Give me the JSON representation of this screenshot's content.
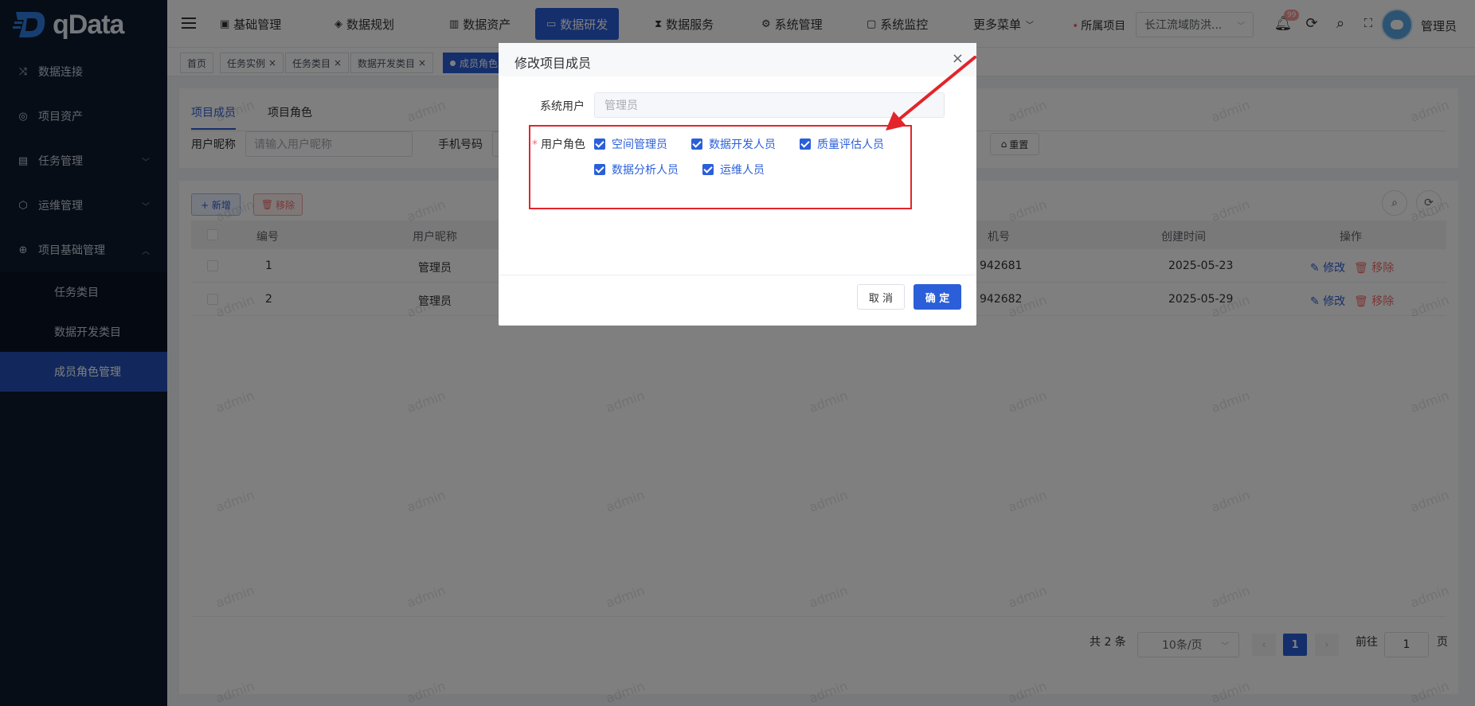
{
  "app": {
    "name": "qData"
  },
  "sidebar": {
    "items": [
      {
        "label": "数据连接",
        "icon": "shuffle-icon"
      },
      {
        "label": "项目资产",
        "icon": "asset-icon"
      },
      {
        "label": "任务管理",
        "icon": "doc-icon",
        "expandable": true
      },
      {
        "label": "运维管理",
        "icon": "cube-icon",
        "expandable": true
      },
      {
        "label": "项目基础管理",
        "icon": "globe-icon",
        "expandable": true,
        "expanded": true
      }
    ],
    "sub_items": [
      {
        "label": "任务类目"
      },
      {
        "label": "数据开发类目"
      },
      {
        "label": "成员角色管理",
        "active": true
      }
    ]
  },
  "header": {
    "nav": [
      {
        "label": "基础管理",
        "icon": "base-icon"
      },
      {
        "label": "数据规划",
        "icon": "layers-icon"
      },
      {
        "label": "数据资产",
        "icon": "asset-book-icon"
      },
      {
        "label": "数据研发",
        "icon": "dev-icon",
        "active": true
      },
      {
        "label": "数据服务",
        "icon": "hourglass-icon"
      },
      {
        "label": "系统管理",
        "icon": "settings-icon"
      },
      {
        "label": "系统监控",
        "icon": "monitor-icon"
      },
      {
        "label": "更多菜单",
        "icon": "chevron-down-icon"
      }
    ],
    "project_label": "所属项目",
    "project_value": "长江流域防洪...",
    "notify_badge": "99",
    "user_name": "管理员"
  },
  "tags": [
    {
      "label": "首页"
    },
    {
      "label": "任务实例"
    },
    {
      "label": "任务类目"
    },
    {
      "label": "数据开发类目"
    },
    {
      "label": "成员角色",
      "active": true
    }
  ],
  "main": {
    "tabs": [
      {
        "label": "项目成员",
        "active": true
      },
      {
        "label": "项目角色"
      }
    ],
    "filters": {
      "nickname_label": "用户昵称",
      "nickname_placeholder": "请输入用户昵称",
      "phone_label": "手机号码",
      "reset_label": "重置"
    },
    "toolbar": {
      "add_label": "+ 新增",
      "remove_label": "移除"
    },
    "table": {
      "columns": [
        "编号",
        "用户昵称",
        "机号",
        "创建时间",
        "操作"
      ],
      "rows": [
        {
          "id": "1",
          "nickname": "管理员",
          "phone": "942681",
          "created": "2025-05-23"
        },
        {
          "id": "2",
          "nickname": "管理员",
          "phone": "942682",
          "created": "2025-05-29"
        }
      ],
      "edit_label": "修改",
      "remove_label": "移除"
    },
    "pagination": {
      "total": "共 2 条",
      "page_size": "10条/页",
      "current": "1",
      "goto_label": "前往",
      "goto_value": "1",
      "page_unit": "页"
    },
    "watermark": "admin"
  },
  "dialog": {
    "title": "修改项目成员",
    "system_user_label": "系统用户",
    "system_user_value": "管理员",
    "role_label": "用户角色",
    "roles": [
      {
        "label": "空间管理员",
        "checked": true
      },
      {
        "label": "数据开发人员",
        "checked": true
      },
      {
        "label": "质量评估人员",
        "checked": true
      },
      {
        "label": "数据分析人员",
        "checked": true
      },
      {
        "label": "运维人员",
        "checked": true
      }
    ],
    "cancel_label": "取 消",
    "ok_label": "确 定"
  },
  "colors": {
    "primary": "#2b5fd9",
    "sidebar": "#0f1b2e",
    "danger": "#f56c6c",
    "highlight": "#e3242b"
  }
}
